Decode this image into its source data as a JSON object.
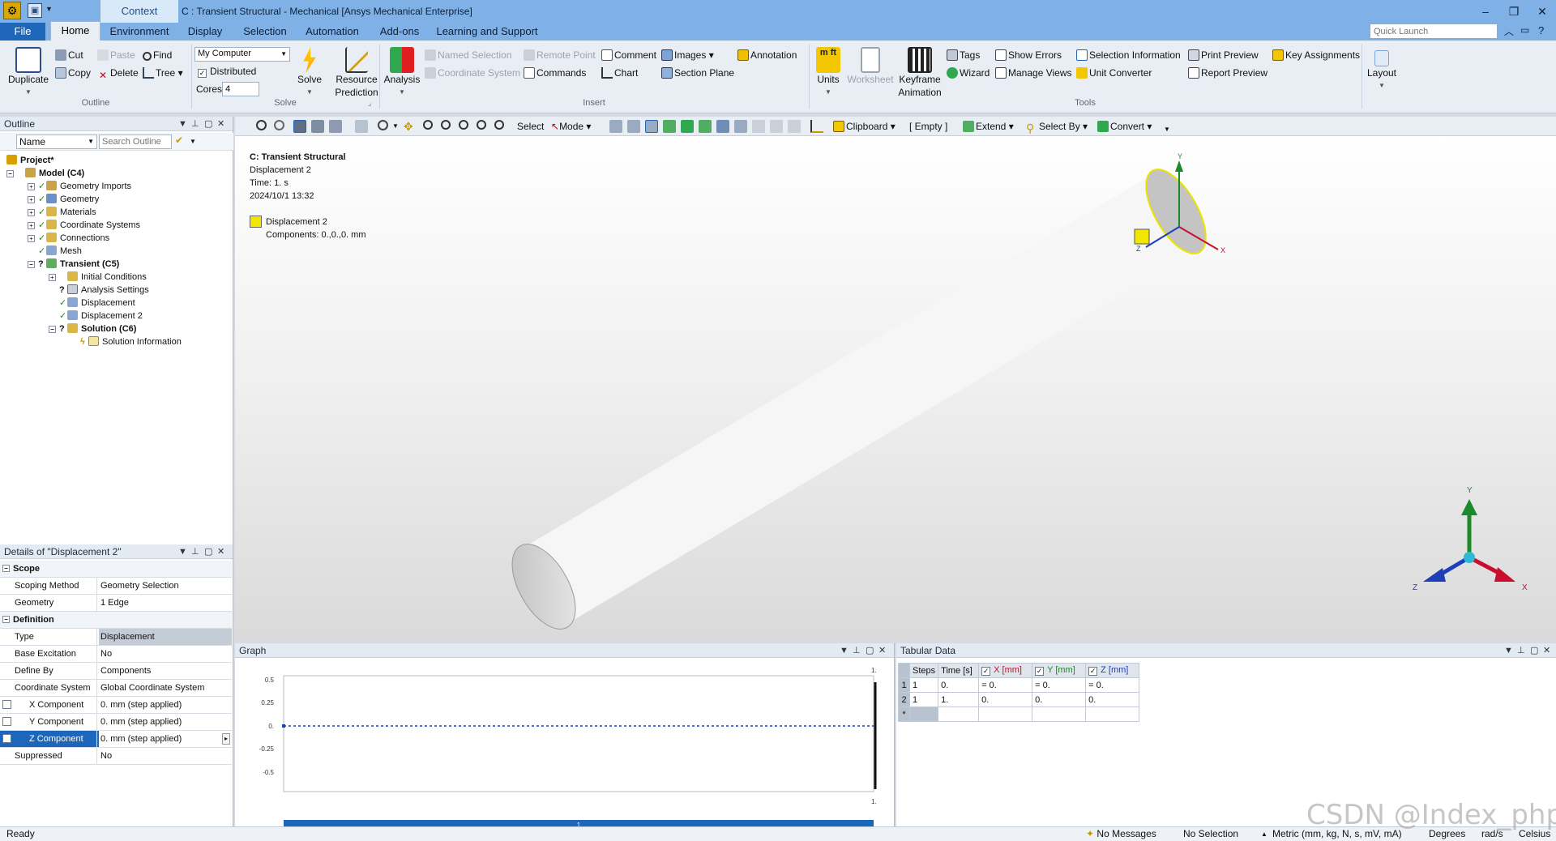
{
  "title_bar": {
    "context_tab": "Context",
    "window_title": "C : Transient Structural - Mechanical [Ansys Mechanical Enterprise]",
    "minimize": "–",
    "restore": "❐",
    "close": "✕"
  },
  "menu": {
    "file": "File",
    "tabs": [
      "Home",
      "Environment",
      "Display",
      "Selection",
      "Automation",
      "Add-ons",
      "Learning and Support"
    ],
    "quick_launch_placeholder": "Quick Launch"
  },
  "ribbon": {
    "outline": {
      "duplicate": "Duplicate",
      "cut": "Cut",
      "copy": "Copy",
      "paste": "Paste",
      "delete": "Delete",
      "find": "Find",
      "tree": "Tree",
      "group_label": "Outline"
    },
    "solve": {
      "computer": "My Computer",
      "distributed": "Distributed",
      "cores_label": "Cores",
      "cores_value": "4",
      "solve": "Solve",
      "resource_prediction_1": "Resource",
      "resource_prediction_2": "Prediction",
      "group_label": "Solve"
    },
    "insert": {
      "analysis": "Analysis",
      "named_selection": "Named Selection",
      "coordinate_system": "Coordinate System",
      "remote_point": "Remote Point",
      "commands": "Commands",
      "comment": "Comment",
      "chart": "Chart",
      "images": "Images",
      "section_plane": "Section Plane",
      "annotation": "Annotation",
      "group_label": "Insert"
    },
    "tools": {
      "units": "Units",
      "worksheet": "Worksheet",
      "keyframe_1": "Keyframe",
      "keyframe_2": "Animation",
      "tags": "Tags",
      "wizard": "Wizard",
      "show_errors": "Show Errors",
      "manage_views": "Manage Views",
      "selection_information": "Selection Information",
      "unit_converter": "Unit Converter",
      "print_preview": "Print Preview",
      "report_preview": "Report Preview",
      "key_assignments": "Key Assignments",
      "group_label": "Tools"
    },
    "layout": "Layout"
  },
  "outline_panel": {
    "title": "Outline",
    "filter_name": "Name",
    "search_placeholder": "Search Outline",
    "tree": [
      {
        "label": "Project*",
        "bold": true
      },
      {
        "label": "Model (C4)",
        "bold": true
      },
      {
        "label": "Geometry Imports"
      },
      {
        "label": "Geometry"
      },
      {
        "label": "Materials"
      },
      {
        "label": "Coordinate Systems"
      },
      {
        "label": "Connections"
      },
      {
        "label": "Mesh"
      },
      {
        "label": "Transient (C5)",
        "bold": true
      },
      {
        "label": "Initial Conditions"
      },
      {
        "label": "Analysis Settings"
      },
      {
        "label": "Displacement"
      },
      {
        "label": "Displacement 2"
      },
      {
        "label": "Solution (C6)",
        "bold": true
      },
      {
        "label": "Solution Information"
      }
    ]
  },
  "details_panel": {
    "title": "Details of \"Displacement 2\"",
    "rows": [
      {
        "section": "Scope"
      },
      {
        "key": "Scoping Method",
        "value": "Geometry Selection"
      },
      {
        "key": "Geometry",
        "value": "1 Edge"
      },
      {
        "section": "Definition"
      },
      {
        "key": "Type",
        "value": "Displacement"
      },
      {
        "key": "Base Excitation",
        "value": "No"
      },
      {
        "key": "Define By",
        "value": "Components"
      },
      {
        "key": "Coordinate System",
        "value": "Global Coordinate System"
      },
      {
        "key": "X Component",
        "value": "0. mm  (step applied)"
      },
      {
        "key": "Y Component",
        "value": "0. mm  (step applied)"
      },
      {
        "key": "Z Component",
        "value": "0. mm  (step applied)"
      },
      {
        "key": "Suppressed",
        "value": "No"
      }
    ]
  },
  "graphics_toolbar": {
    "select": "Select",
    "mode": "Mode",
    "clipboard": "Clipboard",
    "empty": "[ Empty ]",
    "extend": "Extend",
    "select_by": "Select By",
    "convert": "Convert"
  },
  "viewport": {
    "title": "C: Transient Structural",
    "object": "Displacement 2",
    "time": "Time: 1. s",
    "date": "2024/10/1 13:32",
    "legend_name": "Displacement 2",
    "legend_components": "Components: 0.,0.,0. mm",
    "legend_color": "#f2e600",
    "triad": {
      "x": "X",
      "y": "Y",
      "z": "Z"
    }
  },
  "graph_panel": {
    "title": "Graph",
    "y_ticks": [
      "0.5",
      "0.25",
      "0.",
      "-0.25",
      "-0.5"
    ],
    "top_label": "1.",
    "bottom_label": "1.",
    "timeline_label": "1"
  },
  "tabular_panel": {
    "title": "Tabular Data",
    "headers": [
      "Steps",
      "Time [s]",
      "X [mm]",
      "Y [mm]",
      "Z [mm]"
    ],
    "rows": [
      [
        "1",
        "1",
        "0.",
        "= 0.",
        "= 0.",
        "= 0."
      ],
      [
        "2",
        "1",
        "1.",
        "0.",
        "0.",
        "0."
      ],
      [
        "*",
        "",
        "",
        "",
        "",
        ""
      ]
    ]
  },
  "status_bar": {
    "ready": "Ready",
    "messages": "No Messages",
    "selection": "No Selection",
    "units": "Metric (mm, kg, N, s, mV, mA)",
    "angle": "Degrees",
    "rate": "rad/s",
    "temp": "Celsius"
  },
  "watermark": "CSDN @Index_php",
  "colors": {
    "accent": "#1e66b9",
    "title_bar": "#7fb1e6",
    "check_ok": "#2a8a2a",
    "axis_x": "#c8102e",
    "axis_y": "#1a8a2a",
    "axis_z": "#1f3fb8"
  }
}
